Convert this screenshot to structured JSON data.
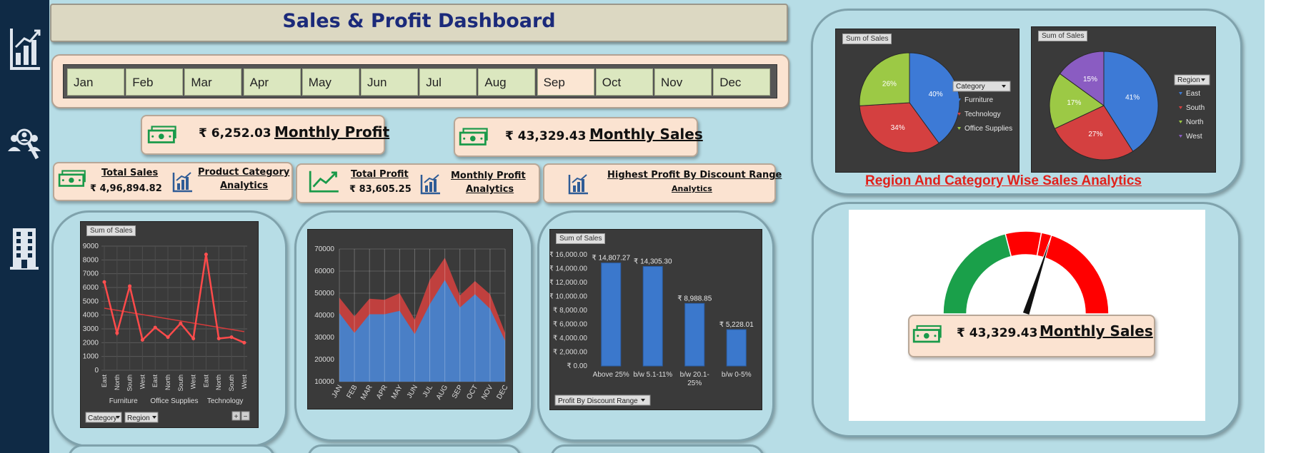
{
  "title": "Sales & Profit Dashboard",
  "sidebar": {
    "items": [
      "chart-icon",
      "people-search-icon",
      "building-icon"
    ]
  },
  "months": [
    "Jan",
    "Feb",
    "Mar",
    "Apr",
    "May",
    "Jun",
    "Jul",
    "Aug",
    "Sep",
    "Oct",
    "Nov",
    "Dec"
  ],
  "selected_month": "Sep",
  "kpis": {
    "monthly_profit": {
      "value": "₹ 6,252.03",
      "label": "Monthly Profit"
    },
    "monthly_sales": {
      "value": "₹ 43,329.43",
      "label": "Monthly Sales"
    }
  },
  "nav": {
    "total_sales": {
      "label": "Total Sales",
      "value": "₹ 4,96,894.82",
      "link_line1": "Product  Category",
      "link_line2": "Analytics"
    },
    "total_profit": {
      "label": "Total Profit",
      "value": "₹ 83,605.25",
      "link_line1": "Monthly  Profit",
      "link_line2": "Analytics"
    },
    "discount": {
      "link_line1": "Highest  Profit By Discount Range",
      "link_line2": "Analytics"
    }
  },
  "region_caption": "Region And Category Wise Sales Analytics",
  "gauge": {
    "value": "₹ 43,329.43",
    "label": "Monthly  Sales",
    "needle_fraction": 0.6,
    "colors": [
      "#1aa04a",
      "#ff0000"
    ]
  },
  "colors": {
    "sidebar": "#0f2a45",
    "title": "#1b2a7a",
    "accent_red": "#e0201a",
    "icon_green": "#1a9a4a",
    "icon_blue": "#2f5c96"
  },
  "chart_data": [
    {
      "type": "pie",
      "button": "Sum of Sales",
      "filter": "Category",
      "slices": [
        {
          "name": "Furniture",
          "value": 40,
          "label": "40%",
          "color": "#3d7ad6"
        },
        {
          "name": "Technology",
          "value": 34,
          "label": "34%",
          "color": "#d44040"
        },
        {
          "name": "Office Supplies",
          "value": 26,
          "label": "26%",
          "color": "#9cc945"
        }
      ]
    },
    {
      "type": "pie",
      "button": "Sum of Sales",
      "filter": "Region",
      "slices": [
        {
          "name": "East",
          "value": 41,
          "label": "41%",
          "color": "#3d7ad6"
        },
        {
          "name": "South",
          "value": 27,
          "label": "27%",
          "color": "#d44040"
        },
        {
          "name": "North",
          "value": 17,
          "label": "17%",
          "color": "#9cc945"
        },
        {
          "name": "West",
          "value": 15,
          "label": "15%",
          "color": "#8a5cc2"
        }
      ]
    },
    {
      "type": "line",
      "button": "Sum of Sales",
      "x": [
        "East",
        "North",
        "South",
        "West",
        "East",
        "North",
        "South",
        "West",
        "East",
        "North",
        "South",
        "West"
      ],
      "groups": [
        "Furniture",
        "Office Supplies",
        "Technology"
      ],
      "values": [
        6400,
        2700,
        6100,
        2200,
        3100,
        2400,
        3400,
        2300,
        8400,
        2300,
        2400,
        2000
      ],
      "trend": [
        4500,
        2800
      ],
      "ylim": [
        0,
        9000
      ],
      "yticks": [
        "0",
        "1000",
        "2000",
        "3000",
        "4000",
        "5000",
        "6000",
        "7000",
        "8000",
        "9000"
      ],
      "filters": [
        "Category",
        "Region"
      ],
      "zoom": [
        "+",
        "−"
      ]
    },
    {
      "type": "area",
      "x": [
        "JAN",
        "FEB",
        "MAR",
        "APR",
        "MAY",
        "JUN",
        "JUL",
        "AUG",
        "SEP",
        "OCT",
        "NOV",
        "DEC"
      ],
      "series": [
        {
          "values": [
            48000,
            39500,
            47500,
            47000,
            50000,
            38000,
            56000,
            66000,
            49000,
            55500,
            49500,
            32000
          ],
          "color": "#c0403e"
        },
        {
          "values": [
            41000,
            32000,
            40500,
            40500,
            42000,
            31500,
            45000,
            56000,
            43500,
            49500,
            43000,
            28500
          ],
          "color": "#4a7fc6"
        }
      ],
      "ylim": [
        10000,
        70000
      ],
      "yticks": [
        "10000",
        "20000",
        "30000",
        "40000",
        "50000",
        "60000",
        "70000"
      ]
    },
    {
      "type": "bar",
      "button": "Sum of Sales",
      "filter": "Profit By Discount Range",
      "categories": [
        [
          "Above 25%"
        ],
        [
          "b/w 5.1-11%"
        ],
        [
          "b/w 20.1-",
          "25%"
        ],
        [
          "b/w 0-5%"
        ]
      ],
      "values": [
        14807.27,
        14305.3,
        8988.85,
        5228.01
      ],
      "labels": [
        "₹ 14,807.27",
        "₹ 14,305.30",
        "₹ 8,988.85",
        "₹ 5,228.01"
      ],
      "ylim": [
        0,
        16000
      ],
      "yticks": [
        "₹ 0.00",
        "₹ 2,000.00",
        "₹ 4,000.00",
        "₹ 6,000.00",
        "₹ 8,000.00",
        "₹ 10,000.00",
        "₹ 12,000.00",
        "₹ 14,000.00",
        "₹ 16,000.00"
      ]
    }
  ]
}
